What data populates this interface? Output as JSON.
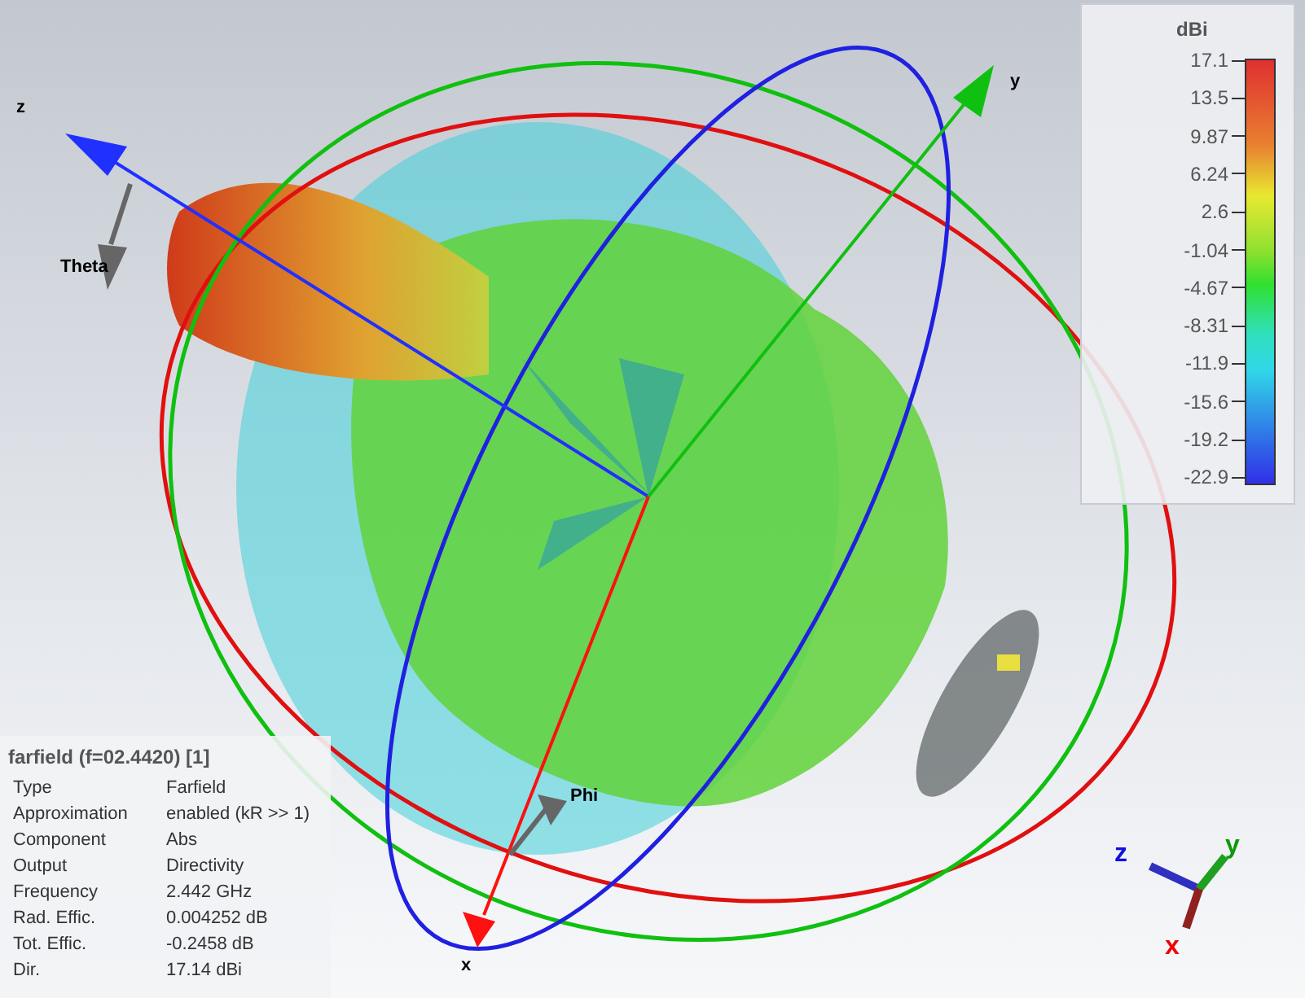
{
  "viewport": {
    "axis_labels": [
      "z",
      "y",
      "x"
    ],
    "angle_labels": [
      {
        "kind": "theta",
        "text": "Theta"
      },
      {
        "kind": "phi",
        "text": "Phi"
      }
    ]
  },
  "legend": {
    "unit": "dBi",
    "ticks": [
      "17.1",
      "13.5",
      "9.87",
      "6.24",
      "2.6",
      "-1.04",
      "-4.67",
      "-8.31",
      "-11.9",
      "-15.6",
      "-19.2",
      "-22.9"
    ]
  },
  "info": {
    "title": "farfield (f=02.4420) [1]",
    "rows": [
      {
        "label": "Type",
        "value": "Farfield"
      },
      {
        "label": "Approximation",
        "value": "enabled (kR >> 1)"
      },
      {
        "label": "Component",
        "value": "Abs"
      },
      {
        "label": "Output",
        "value": "Directivity"
      },
      {
        "label": "Frequency",
        "value": "2.442 GHz"
      },
      {
        "label": "Rad. Effic.",
        "value": "0.004252 dB"
      },
      {
        "label": "Tot. Effic.",
        "value": "-0.2458 dB"
      },
      {
        "label": "Dir.",
        "value": "17.14 dBi"
      }
    ]
  },
  "triad": {
    "labels": [
      "z",
      "y",
      "x"
    ]
  }
}
